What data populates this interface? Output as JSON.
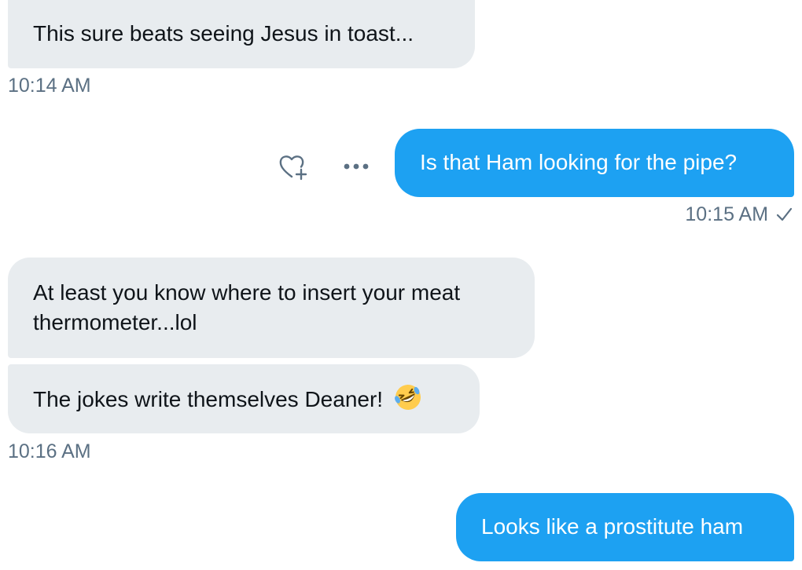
{
  "colors": {
    "sent_bubble": "#1da1f2",
    "received_bubble": "#e8ecef",
    "timestamp": "#5b7083"
  },
  "messages": [
    {
      "direction": "received",
      "text": "This sure beats seeing Jesus in toast..."
    },
    {
      "direction": "sent",
      "text": "Is that Ham looking for the pipe?"
    },
    {
      "direction": "received",
      "text": "At least you know where to insert your meat thermometer...lol"
    },
    {
      "direction": "received",
      "text": "The jokes write themselves Deaner!",
      "emoji": "rolling-on-floor-laughing"
    },
    {
      "direction": "sent",
      "text": "Looks like a prostitute ham"
    }
  ],
  "timestamps": {
    "t1": "10:14 AM",
    "t2": "10:15 AM",
    "t3": "10:16 AM"
  },
  "icons": {
    "react": "heart-plus-icon",
    "more": "more-dots-icon",
    "read_receipt": "checkmark-icon"
  }
}
